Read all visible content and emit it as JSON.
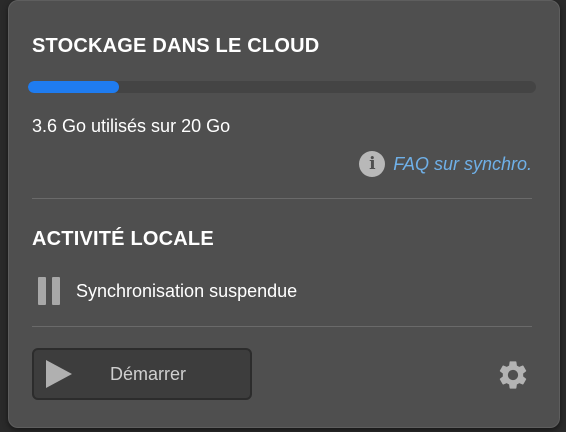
{
  "cloud_storage": {
    "title": "STOCKAGE DANS LE CLOUD",
    "used_fraction": 0.18,
    "usage_text": "3.6 Go utilisés sur 20 Go",
    "faq_label": "FAQ sur synchro.",
    "info_icon": "info-icon"
  },
  "local_activity": {
    "title": "ACTIVITÉ LOCALE",
    "status_text": "Synchronisation suspendue",
    "status_icon": "pause-icon"
  },
  "footer": {
    "start_button_label": "Démarrer",
    "start_icon": "play-icon",
    "settings_icon": "gear-icon"
  },
  "colors": {
    "panel_bg": "#4f4f4f",
    "progress_fill": "#1f7cf0",
    "link": "#6fb0e8"
  }
}
